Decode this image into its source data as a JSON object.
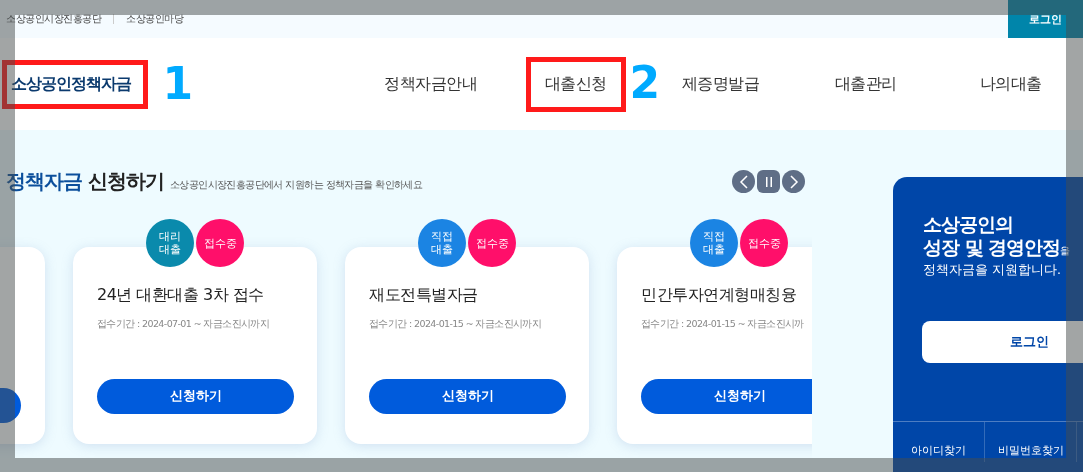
{
  "top_bar": {
    "links": [
      "소상공인시장진흥공단",
      "소상공인마당"
    ],
    "login": "로그인"
  },
  "header": {
    "logo": "소상공인정책자금",
    "logo_marker": "1",
    "nav": [
      {
        "label": "정책자금안내",
        "highlighted": false
      },
      {
        "label": "대출신청",
        "highlighted": true,
        "marker": "2"
      },
      {
        "label": "제증명발급",
        "highlighted": false
      },
      {
        "label": "대출관리",
        "highlighted": false
      },
      {
        "label": "나의대출",
        "highlighted": false
      }
    ]
  },
  "section": {
    "title_accent": "정책자금",
    "title": "신청하기",
    "subtitle": "소상공인시장진흥공단에서 지원하는 정책자금을 확인하세요"
  },
  "carousel": {
    "cards": [
      {
        "kind": "partial"
      },
      {
        "kind": "card",
        "badges": [
          {
            "label": "대리\n대출",
            "color": "#0a8aac"
          },
          {
            "label": "접수중",
            "color": "#ff0f6a"
          }
        ],
        "title": "24년 대환대출 3차 접수",
        "period": "접수기간 : 2024-07-01 ~ 자금소진시까지",
        "button": "신청하기"
      },
      {
        "kind": "card",
        "badges": [
          {
            "label": "직접\n대출",
            "color": "#1b84e3"
          },
          {
            "label": "접수중",
            "color": "#ff0f6a"
          }
        ],
        "title": "재도전특별자금",
        "period": "접수기간 : 2024-01-15 ~ 자금소진시까지",
        "button": "신청하기"
      },
      {
        "kind": "card",
        "badges": [
          {
            "label": "직접\n대출",
            "color": "#1b84e3"
          },
          {
            "label": "접수중",
            "color": "#ff0f6a"
          }
        ],
        "title": "민간투자연계형매칭융",
        "period": "접수기간 : 2024-01-15 ~ 자금소진시까",
        "button": "신청하기"
      }
    ]
  },
  "login_panel": {
    "heading_lines": [
      "소상공인의",
      "성장 및 경영안정"
    ],
    "heading_tail": "을",
    "text": "정책자금을 지원합니다.",
    "button": "로그인",
    "links": [
      "아이디찾기",
      "비밀번호찾기"
    ]
  }
}
